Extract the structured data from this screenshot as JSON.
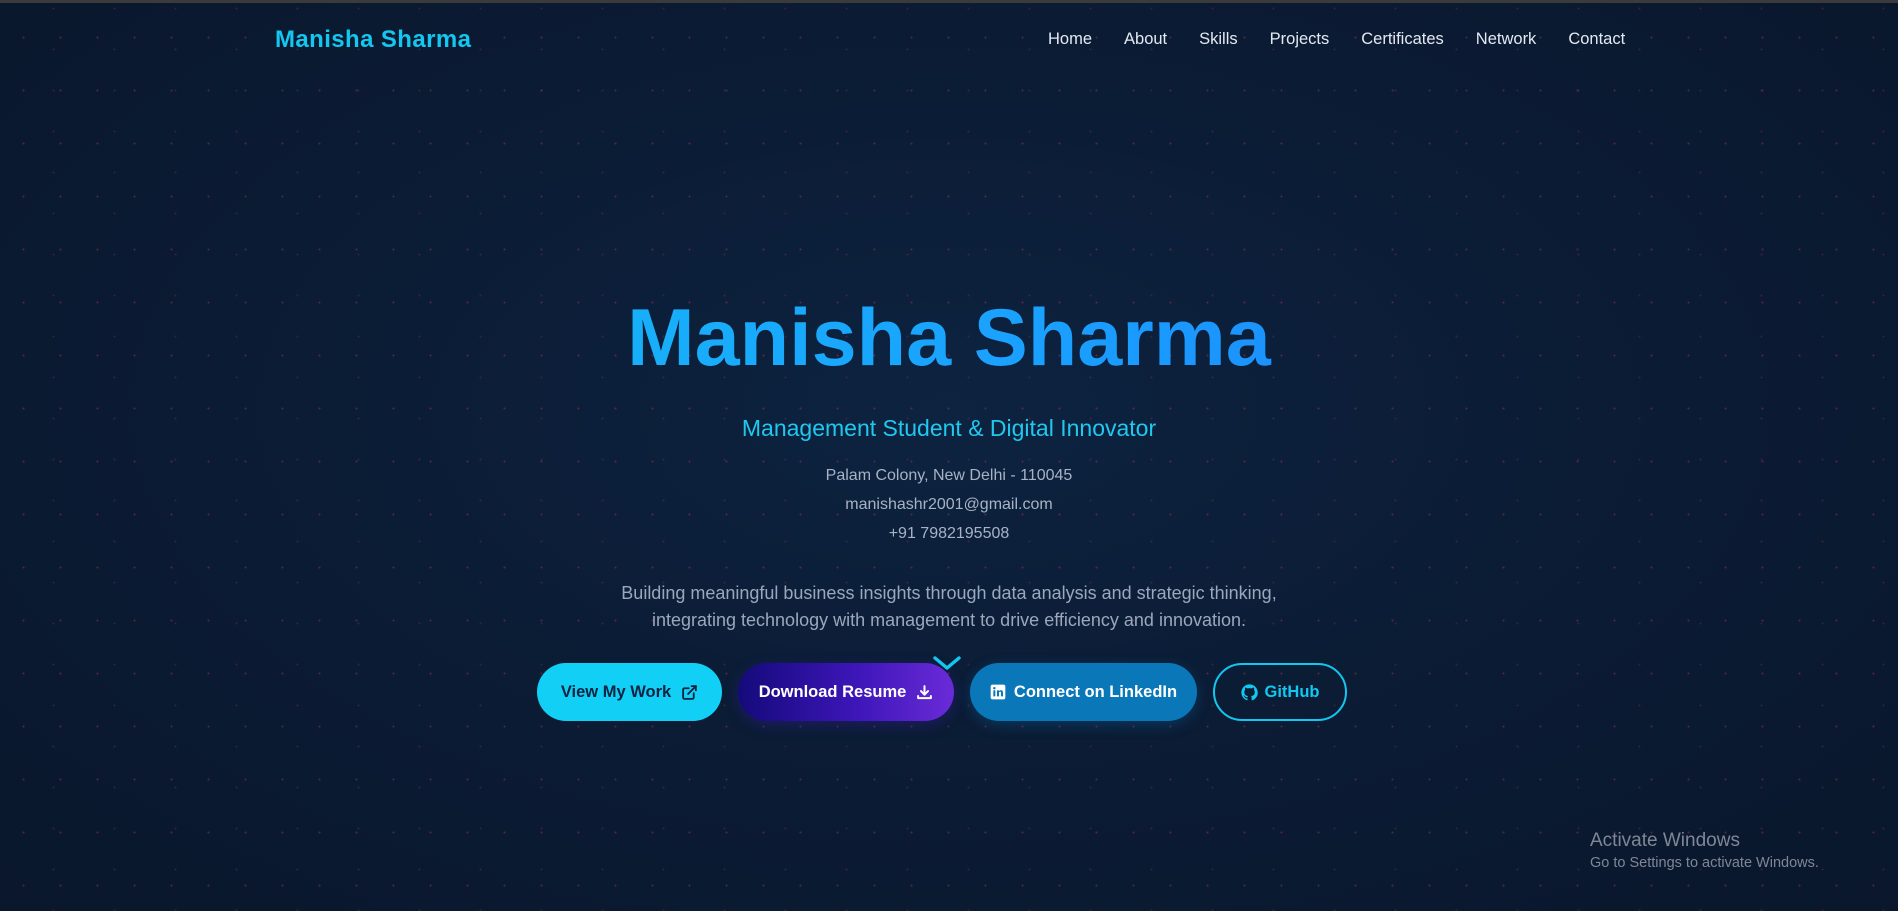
{
  "header": {
    "brand": "Manisha Sharma",
    "nav": [
      "Home",
      "About",
      "Skills",
      "Projects",
      "Certificates",
      "Network",
      "Contact"
    ]
  },
  "hero": {
    "name": "Manisha Sharma",
    "subtitle": "Management Student & Digital Innovator",
    "address": "Palam Colony, New Delhi - 110045",
    "email": "manishashr2001@gmail.com",
    "phone": "+91 7982195508",
    "tagline_line1": "Building meaningful business insights through data analysis and strategic thinking,",
    "tagline_line2": "integrating technology with management to drive efficiency and innovation."
  },
  "buttons": {
    "work": "View My Work",
    "resume": "Download Resume",
    "linkedin": "Connect on LinkedIn",
    "github": "GitHub"
  },
  "icons": {
    "work": "external-link-icon",
    "resume": "download-icon",
    "linkedin": "linkedin-icon",
    "github": "github-icon",
    "scroll": "chevron-down-icon"
  },
  "colors": {
    "accent": "#12c7f0",
    "brand_gradient_start": "#14c6f2",
    "brand_gradient_end": "#1e6df4",
    "resume_gradient_start": "#140a7a",
    "resume_gradient_end": "#6a2bd8",
    "linkedin": "#0a77b8",
    "background": "#0b1c35"
  },
  "watermark": {
    "title": "Activate Windows",
    "subtitle": "Go to Settings to activate Windows."
  }
}
